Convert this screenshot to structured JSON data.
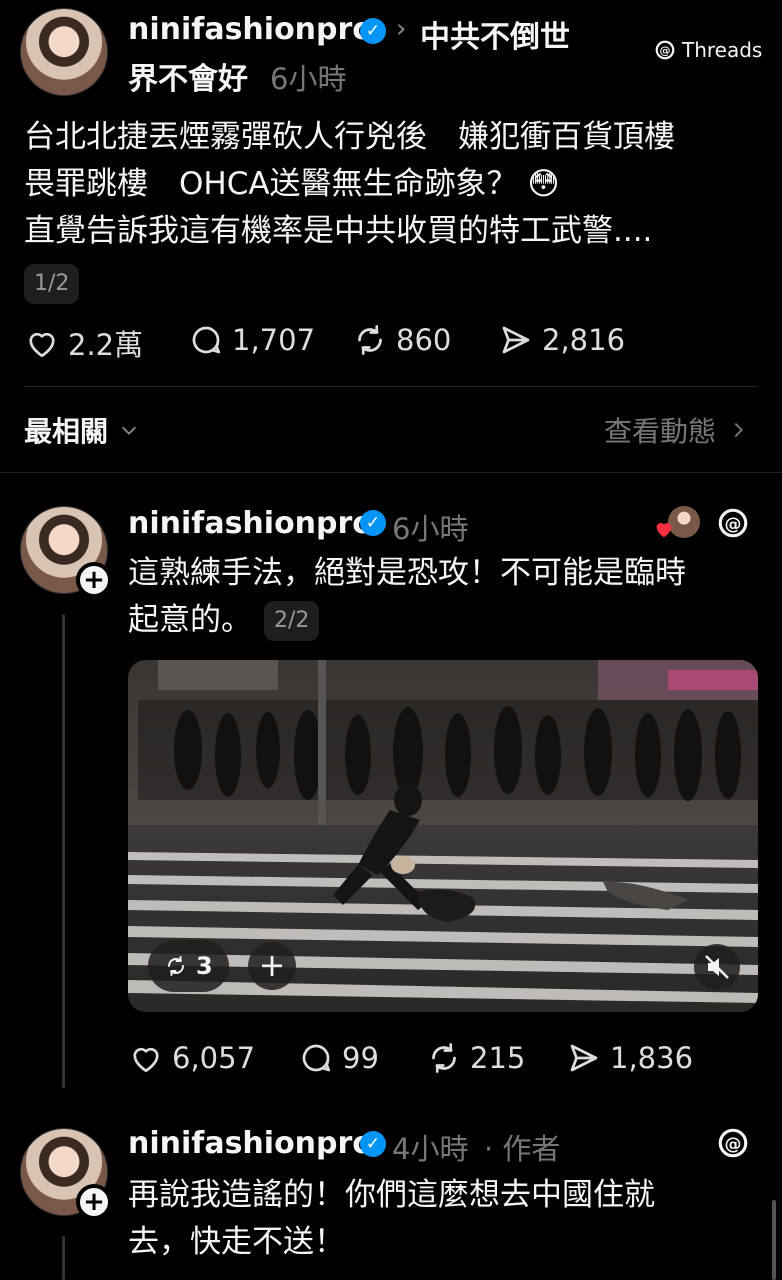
{
  "post": {
    "username": "ninifashionpro",
    "breadcrumb": "中共不倒世",
    "breadcrumb_cont": "界不會好",
    "time": "6小時",
    "brand": "Threads",
    "text_lines": [
      "台北北捷丟煙霧彈砍人行兇後　嫌犯衝百貨頂樓",
      "畏罪跳樓　OHCA送醫無生命跡象？ 😳",
      "直覺告訴我這有機率是中共收買的特工武警...."
    ],
    "page_indicator": "1/2",
    "likes": "2.2萬",
    "replies": "1,707",
    "reposts": "860",
    "shares": "2,816"
  },
  "sort_bar": {
    "label": "最相關",
    "activity_link": "查看動態"
  },
  "reply1": {
    "username": "ninifashionpro",
    "time": "6小時",
    "text_line1": "這熟練手法，絕對是恐攻！不可能是臨時",
    "text_line2": "起意的。",
    "page_indicator": "2/2",
    "video_repost_count": "3",
    "likes": "6,057",
    "replies": "99",
    "reposts": "215",
    "shares": "1,836"
  },
  "reply2": {
    "username": "ninifashionpro",
    "time": "4小時",
    "author_tag": "· 作者",
    "text_line1": "再說我造謠的！你們這麼想去中國住就",
    "text_line2": "去，快走不送！"
  },
  "colors": {
    "background": "#000000",
    "text": "#f3f5f7",
    "muted": "#777777",
    "verified": "#0095f6",
    "like_heart": "#ff3040"
  }
}
